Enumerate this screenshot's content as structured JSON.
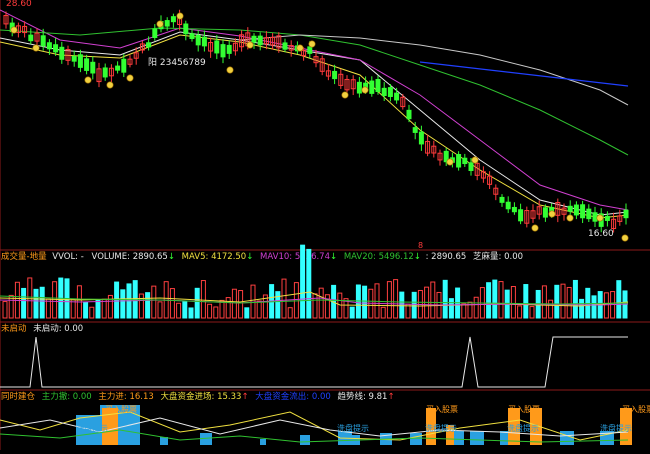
{
  "colors": {
    "background": "#000000",
    "panel_border": "#8b1a1a",
    "up_candle": "#ff3b3b",
    "down_candle": "#33ff33",
    "ma_white": "#e8e8e8",
    "ma_yellow": "#f0e040",
    "ma_purple": "#d040d0",
    "ma_green": "#30c030",
    "trend_blue": "#2040ff",
    "volume_cyan": "#33ffff",
    "volume_red": "#ff4040",
    "orange_bar": "#ff9a1a",
    "blue_bar": "#2aa0e0",
    "signal_white": "#e8e8e8"
  },
  "price_panel": {
    "high_label": "28.60",
    "low_label": "16.60",
    "middle_label": "阳 23456789",
    "bottom_marker": "8"
  },
  "volume_panel": {
    "title": "成交量-地量",
    "vvol_label": "VVOL: -",
    "volume_label": "VOLUME: 2890.65",
    "mav5_label": "MAV5: 4172.50",
    "mav10_label": "MAV10: 5136.74",
    "mav20_label": "MAV20: 5496.12",
    "extra_value": ": 2890.65",
    "dryvolume_label": "芝麻量: 0.00",
    "arrow_down": "↓"
  },
  "signal_panel": {
    "title": "未启动",
    "value_label": "未启动: 0.00"
  },
  "flow_panel": {
    "title": "同时建仓",
    "zhulitui_label": "主力撤: 0.00",
    "zhulijin_label": "主力进: 16.13",
    "dapan_label": "大盘资金进场: 15.33",
    "dapan_out_label": "大盘资金流出: 0.00",
    "trend_label": "趋势线: 9.81",
    "arrow_up": "↑",
    "buy_label": "买入股票",
    "wash_label": "洗盘提示"
  }
}
